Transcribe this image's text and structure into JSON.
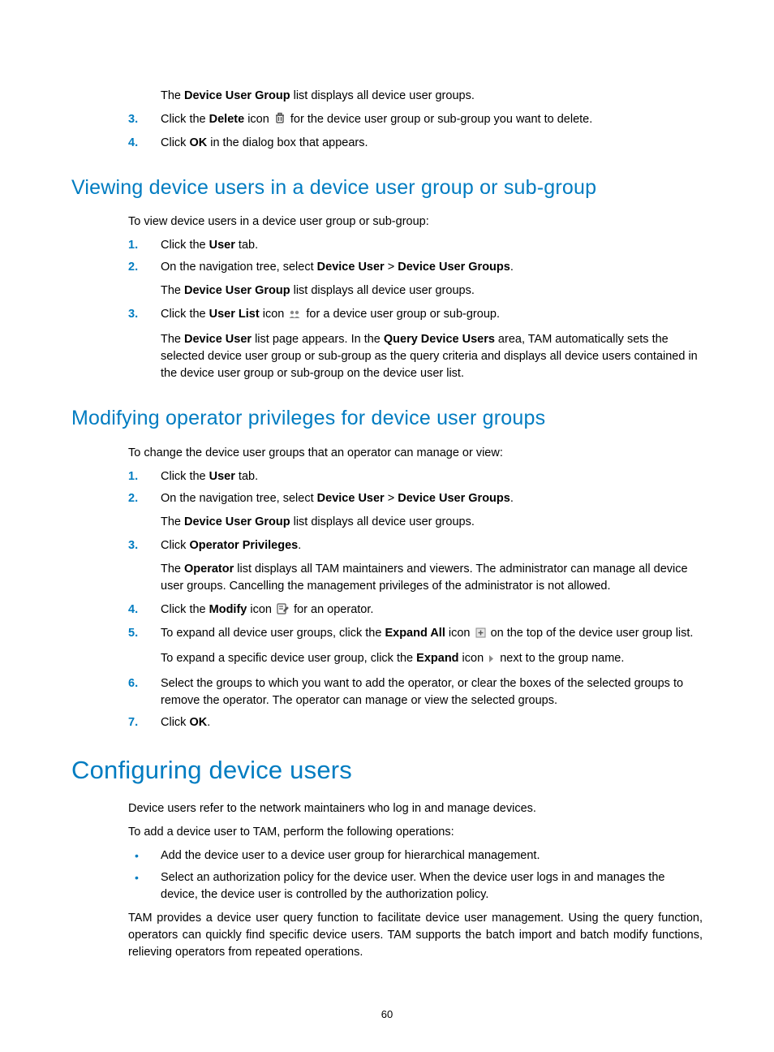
{
  "intro": {
    "line1_a": "The ",
    "line1_b": "Device User Group",
    "line1_c": " list displays all device user groups."
  },
  "topSteps": {
    "s3_a": "Click the ",
    "s3_b": "Delete",
    "s3_c": " icon ",
    "s3_d": " for the device user group or sub-group you want to delete.",
    "s4_a": "Click ",
    "s4_b": "OK",
    "s4_c": " in the dialog box that appears."
  },
  "h_view": "Viewing device users in a device user group or sub-group",
  "view": {
    "intro": "To view device users in a device user group or sub-group:",
    "s1_a": "Click the ",
    "s1_b": "User",
    "s1_c": " tab.",
    "s2_a": "On the navigation tree, select ",
    "s2_b": "Device User",
    "s2_c": " > ",
    "s2_d": "Device User Groups",
    "s2_e": ".",
    "s2_line2_a": "The ",
    "s2_line2_b": "Device User Group",
    "s2_line2_c": " list displays all device user groups.",
    "s3_a": "Click the ",
    "s3_b": "User List",
    "s3_c": " icon ",
    "s3_d": " for a device user group or sub-group.",
    "s3_line2_a": "The ",
    "s3_line2_b": "Device User",
    "s3_line2_c": " list page appears. In the ",
    "s3_line2_d": "Query Device Users",
    "s3_line2_e": " area, TAM automatically sets the selected device user group or sub-group as the query criteria and displays all device users contained in the device user group or sub-group on the device user list."
  },
  "h_modify": "Modifying operator privileges for device user groups",
  "mod": {
    "intro": "To change the device user groups that an operator can manage or view:",
    "s1_a": "Click the ",
    "s1_b": "User",
    "s1_c": " tab.",
    "s2_a": "On the navigation tree, select ",
    "s2_b": "Device User",
    "s2_c": " > ",
    "s2_d": "Device User Groups",
    "s2_e": ".",
    "s2_line2_a": "The ",
    "s2_line2_b": "Device User Group",
    "s2_line2_c": " list displays all device user groups.",
    "s3_a": "Click ",
    "s3_b": "Operator Privileges",
    "s3_c": ".",
    "s3_line2_a": "The ",
    "s3_line2_b": "Operator",
    "s3_line2_c": " list displays all TAM maintainers and viewers. The administrator can manage all device user groups. Cancelling the management privileges of the administrator is not allowed.",
    "s4_a": "Click the ",
    "s4_b": "Modify",
    "s4_c": " icon ",
    "s4_d": " for an operator.",
    "s5_a": "To expand all device user groups, click the ",
    "s5_b": "Expand All",
    "s5_c": " icon ",
    "s5_d": " on the top of the device user group list.",
    "s5_line2_a": "To expand a specific device user group, click the ",
    "s5_line2_b": "Expand",
    "s5_line2_c": " icon ",
    "s5_line2_d": " next to the group name.",
    "s6": "Select the groups to which you want to add the operator, or clear the boxes of the selected groups to remove the operator. The operator can manage or view the selected groups.",
    "s7_a": "Click ",
    "s7_b": "OK",
    "s7_c": "."
  },
  "h_config": "Configuring device users",
  "cfg": {
    "p1": "Device users refer to the network maintainers who log in and manage devices.",
    "p2": "To add a device user to TAM, perform the following operations:",
    "b1": "Add the device user to a device user group for hierarchical management.",
    "b2": "Select an authorization policy for the device user. When the device user logs in and manages the device, the device user is controlled by the authorization policy.",
    "p3": "TAM provides a device user query function to facilitate device user management. Using the query function, operators can quickly find specific device users. TAM supports the batch import and batch modify functions, relieving operators from repeated operations."
  },
  "pageNumber": "60",
  "numbers": {
    "n1": "1.",
    "n2": "2.",
    "n3": "3.",
    "n4": "4.",
    "n5": "5.",
    "n6": "6.",
    "n7": "7."
  }
}
